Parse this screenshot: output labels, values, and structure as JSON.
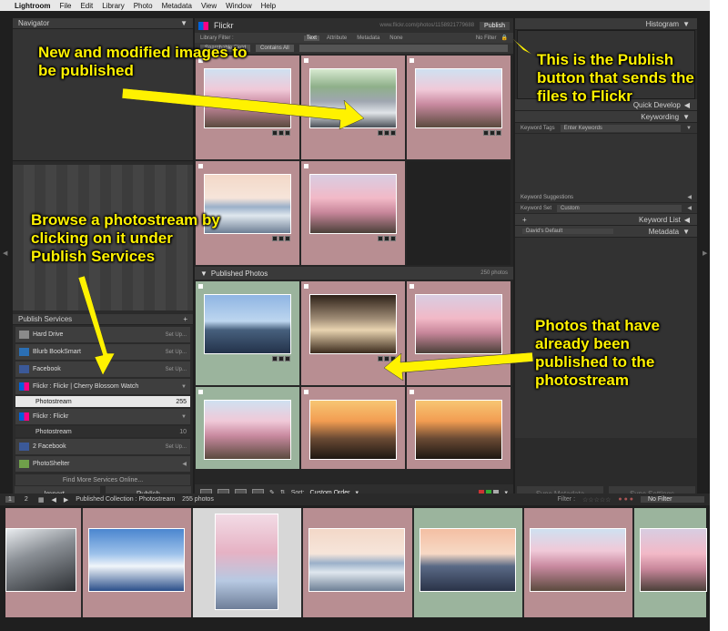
{
  "menubar": {
    "apple": "",
    "app": "Lightroom",
    "items": [
      "File",
      "Edit",
      "Library",
      "Photo",
      "Metadata",
      "View",
      "Window",
      "Help"
    ]
  },
  "left": {
    "navigator": "Navigator",
    "publish_services": "Publish Services",
    "services": [
      {
        "name": "Hard Drive",
        "action": "Set Up...",
        "icon": "hard-drive-icon"
      },
      {
        "name": "Blurb BookSmart",
        "action": "Set Up...",
        "icon": "blurb-icon"
      },
      {
        "name": "Facebook",
        "action": "Set Up...",
        "icon": "facebook-icon"
      },
      {
        "name": "Flickr : Flickr | Cherry Blossom Watch",
        "icon": "flickr-icon"
      },
      {
        "name": "Photostream",
        "count": "255",
        "selected": true
      },
      {
        "name": "Flickr : Flickr",
        "icon": "flickr-icon"
      },
      {
        "name": "Photostream",
        "count": "10"
      },
      {
        "name": "2 Facebook",
        "action": "Set Up...",
        "icon": "facebook-icon"
      },
      {
        "name": "PhotoShelter",
        "icon": "photoshelter-icon"
      }
    ],
    "find_more": "Find More Services Online...",
    "import_label": "Import...",
    "publish_label": "Publish"
  },
  "center": {
    "collection": "Flickr",
    "url": "www.flickr.com/photos/1158921779688",
    "publish_button": "Publish",
    "library_filter": "Library Filter :",
    "filter_tabs": [
      "Text",
      "Attribute",
      "Metadata",
      "None"
    ],
    "no_filter": "No Filter",
    "searchable_field": "Searchable Field",
    "contains_all": "Contains All",
    "published_section": "Published Photos",
    "published_count": "250 photos",
    "sort_label": "Sort:",
    "sort_value": "Custom Order"
  },
  "right": {
    "histogram": "Histogram",
    "quick_develop": "Quick Develop",
    "keywording": "Keywording",
    "keyword_tags": "Keyword Tags",
    "enter_keywords": "Enter Keywords",
    "keyword_suggestions": "Keyword Suggestions",
    "keyword_set": "Keyword Set",
    "keyword_set_value": "Custom",
    "keyword_list": "Keyword List",
    "metadata": "Metadata",
    "metadata_preset": "David's Default",
    "sync_metadata": "Sync Metadata",
    "sync_settings": "Sync Settings"
  },
  "filmstrip": {
    "pages": [
      "1",
      "2"
    ],
    "collection_label": "Published Collection : Photostream",
    "photo_count": "255 photos",
    "filter_label": "Filter :",
    "filter_value": "No Filter"
  },
  "annotations": {
    "new_modified": "New and modified images to be published",
    "publish_button": "This is the Publish button that sends the files to Flickr",
    "browse": "Browse a photostream by clicking on it under Publish Services",
    "already": "Photos that have already been published to the photostream"
  },
  "colors": {
    "pending": "#b88e92",
    "published": "#9bb49d",
    "annotation": "#fff200"
  }
}
